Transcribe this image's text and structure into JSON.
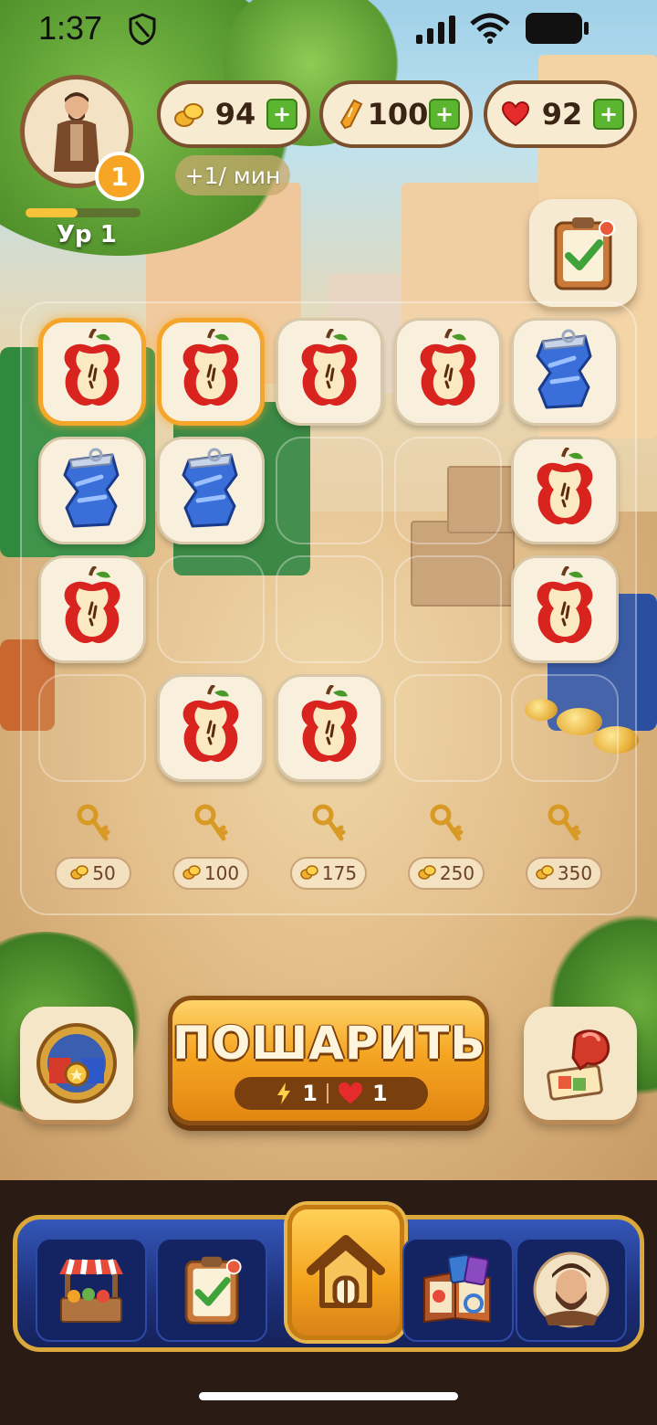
{
  "status_bar": {
    "time": "1:37"
  },
  "player": {
    "level_badge": "1",
    "level_label": "Ур 1",
    "xp_progress": 0.45
  },
  "resources": {
    "coins": {
      "value": "94",
      "icon": "coins-icon"
    },
    "energy": {
      "value": "100",
      "icon": "energy-icon"
    },
    "hearts": {
      "value": "92",
      "icon": "heart-icon"
    },
    "coin_rate": "+1/ мин"
  },
  "board": {
    "cells": [
      "apple_core",
      "apple_core",
      "apple_core",
      "apple_core",
      "can",
      "can",
      "can",
      "empty",
      "empty",
      "apple_core",
      "apple_core",
      "empty",
      "empty",
      "empty",
      "apple_core",
      "empty",
      "apple_core",
      "apple_core",
      "empty",
      "empty"
    ],
    "selected": [
      0,
      1
    ],
    "unlock_costs": [
      "50",
      "100",
      "175",
      "250",
      "350"
    ]
  },
  "merge_button": {
    "label": "ПОШАРИТЬ",
    "energy_cost": "1",
    "heart_cost": "1"
  },
  "side_buttons": {
    "left": "battle-arena-icon",
    "right": "boxing-glove-icon"
  },
  "nav": [
    "shop-stall-icon",
    "tasks-clipboard-icon",
    "home-icon",
    "collection-book-icon",
    "character-portrait-icon"
  ],
  "colors": {
    "accent": "#f5a524",
    "nav_blue": "#1d2f78",
    "gold_border": "#d9a73a"
  }
}
